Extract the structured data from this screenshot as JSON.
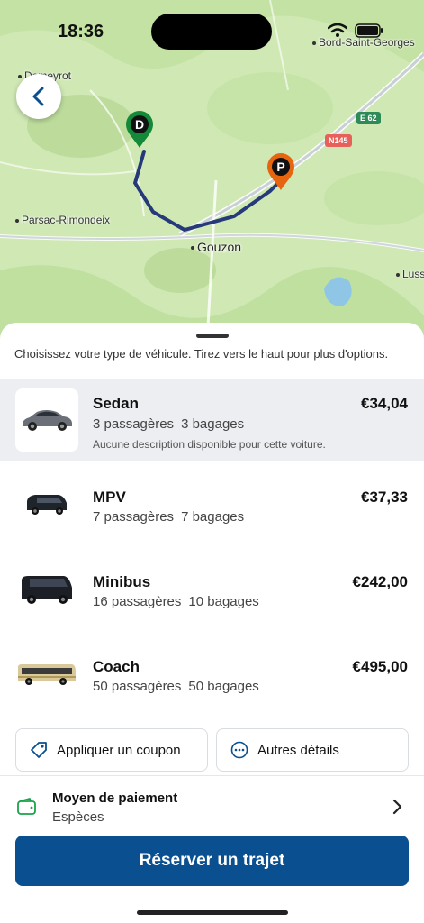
{
  "status": {
    "time": "18:36"
  },
  "map": {
    "places": [
      "Bord-Saint-Georges",
      "Domeyrot",
      "Parsac-Rimondeix",
      "Gouzon",
      "Luss"
    ],
    "road_shields": [
      "E 62",
      "N145"
    ],
    "pins": {
      "origin": "D",
      "destination": "P"
    },
    "colors": {
      "route": "#263a7a",
      "origin_pin": "#14893a",
      "dest_pin": "#e8650f"
    }
  },
  "sheet": {
    "instruction": "Choisissez votre type de véhicule. Tirez vers le haut pour plus d'options.",
    "vehicles": [
      {
        "name": "Sedan",
        "passengers": "3 passagères",
        "luggage": "3 bagages",
        "description": "Aucune description disponible pour cette voiture.",
        "price": "€34,04",
        "icon": "sedan-car-icon"
      },
      {
        "name": "MPV",
        "passengers": "7 passagères",
        "luggage": "7 bagages",
        "price": "€37,33",
        "icon": "mpv-van-icon"
      },
      {
        "name": "Minibus",
        "passengers": "16 passagères",
        "luggage": "10 bagages",
        "price": "€242,00",
        "icon": "minibus-icon"
      },
      {
        "name": "Coach",
        "passengers": "50 passagères",
        "luggage": "50 bagages",
        "price": "€495,00",
        "icon": "coach-bus-icon"
      }
    ],
    "coupon_label": "Appliquer un coupon",
    "details_label": "Autres détails",
    "payment": {
      "title": "Moyen de paiement",
      "value": "Espèces"
    },
    "book_label": "Réserver un trajet",
    "colors": {
      "primary": "#0a4f8f",
      "selected_bg": "#eceef2",
      "wallet": "#1aa34a"
    }
  }
}
